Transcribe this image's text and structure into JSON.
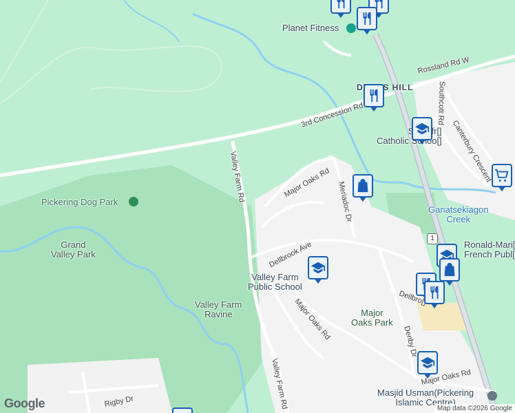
{
  "map": {
    "places": {
      "planet_fitness": "Planet Fitness",
      "dellers_hill": "D[]ERS HILL",
      "st_wilfrid": "St Wilfr[]\nCatholic Schoo[]",
      "pickering_dog_park": "Pickering Dog Park",
      "grand_valley_park": "Grand\nValley Park",
      "valley_farm_ravine": "Valley Farm\nRavine",
      "valley_farm_public_school": "Valley Farm\nPublic School",
      "major_oaks_park": "Major\nOaks Park",
      "ganatsekiagon_creek": "Ganatsekiagon\nCreek",
      "ronald_marion": "Ronald-Mari[]\nFrench Publ[]",
      "masjid_usman": "Masjid Usman(Pickering\nIslamic Centre)"
    },
    "roads": {
      "rossland": "Rossland Rd W",
      "third_concession": "3rd Concession Rd",
      "valley_farm_north": "Valley Farm Rd",
      "valley_farm_south": "Valley Farm Rd",
      "major_oaks_north": "Major Oaks Rd",
      "major_oaks_mid": "Major Oaks Rd",
      "major_oaks_south": "Major Oaks Rd",
      "meriadoc": "Meriadoc Dr",
      "dellbrook": "Dellbrook Ave",
      "dellbrook_east": "Dellbro[]",
      "denby": "Denby Dr",
      "southcott": "Southcott Rd",
      "canterbury": "Canterbury Crescent",
      "rigby": "Rigby Dr",
      "route_badge": "1"
    },
    "icons": [
      "restaurant-icon",
      "school-icon",
      "shopping-bag-icon",
      "shopping-cart-icon",
      "fitness-icon",
      "mosque-icon",
      "park-icon"
    ],
    "colors": {
      "land": "#bfefd3",
      "park": "#a7e0b9",
      "road": "#ffffff",
      "highway": "#b9c2cc",
      "water": "#8fd0f0",
      "pin": "#1a5fb4"
    },
    "attribution": {
      "logo": "Google",
      "credit": "Map data ©2026 Google"
    }
  }
}
